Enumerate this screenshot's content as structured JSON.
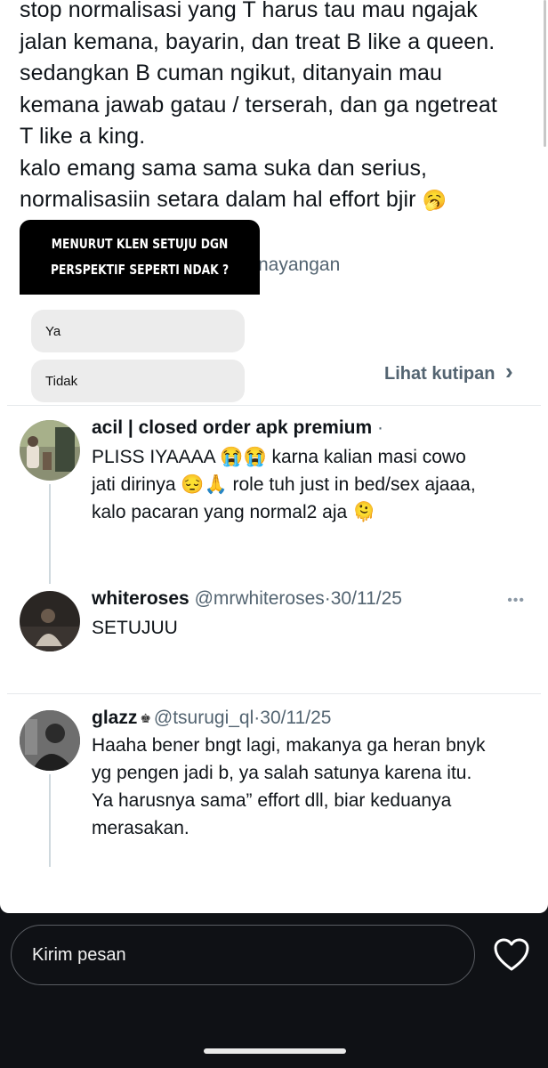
{
  "tweet": {
    "lines": [
      "stop normalisasi yang T harus tau mau ngajak",
      "jalan kemana, bayarin, dan treat B like a queen.",
      "sedangkan B cuman ngikut, ditanyain mau",
      "kemana jawab gatau / terserah, dan ga ngetreat",
      "T like a king.",
      "kalo emang sama sama suka dan serius,",
      "normalisasiin setara dalam hal effort bjir"
    ],
    "end_emoji": "🥱",
    "views_fragment": "nayangan",
    "quote_link": "Lihat kutipan",
    "quote_chevron": "›"
  },
  "poll": {
    "question_line1": "MENURUT KLEN SETUJU DGN",
    "question_line2": "PERSPEKTIF SEPERTI NDAK ?",
    "options": [
      "Ya",
      "Tidak"
    ]
  },
  "replies": [
    {
      "name": "acil | closed order apk premium",
      "handle": "",
      "dot": "·",
      "date": "",
      "lines": [
        "PLISS IYAAAA 😭😭 karna kalian masi cowo",
        "jati dirinya 😔🙏 role tuh just in bed/sex ajaaa,",
        "kalo pacaran yang normal2 aja 🫠"
      ]
    },
    {
      "name": "whiteroses",
      "handle": "@mrwhiteroses",
      "dot": "·",
      "date": "30/11/25",
      "lines": [
        "SETUJUU"
      ]
    },
    {
      "name": "glazz",
      "handle": "@tsurugi_ql",
      "dot": "·",
      "date": "30/11/25",
      "lines": [
        "Haaha bener bngt lagi, makanya ga heran bnyk",
        "yg pengen jadi b, ya salah satunya karena itu.",
        "Ya harusnya sama” effort dll, biar keduanya",
        "merasakan."
      ]
    }
  ],
  "more_icon": "•••",
  "badge_icon": "♚",
  "message_bar": {
    "placeholder": "Kirim pesan",
    "like_icon": "heart-outline"
  },
  "colors": {
    "text": "#0f1419",
    "meta": "#536471",
    "story_bg": "#ffffff",
    "bottom_bg": "#0f1115"
  }
}
